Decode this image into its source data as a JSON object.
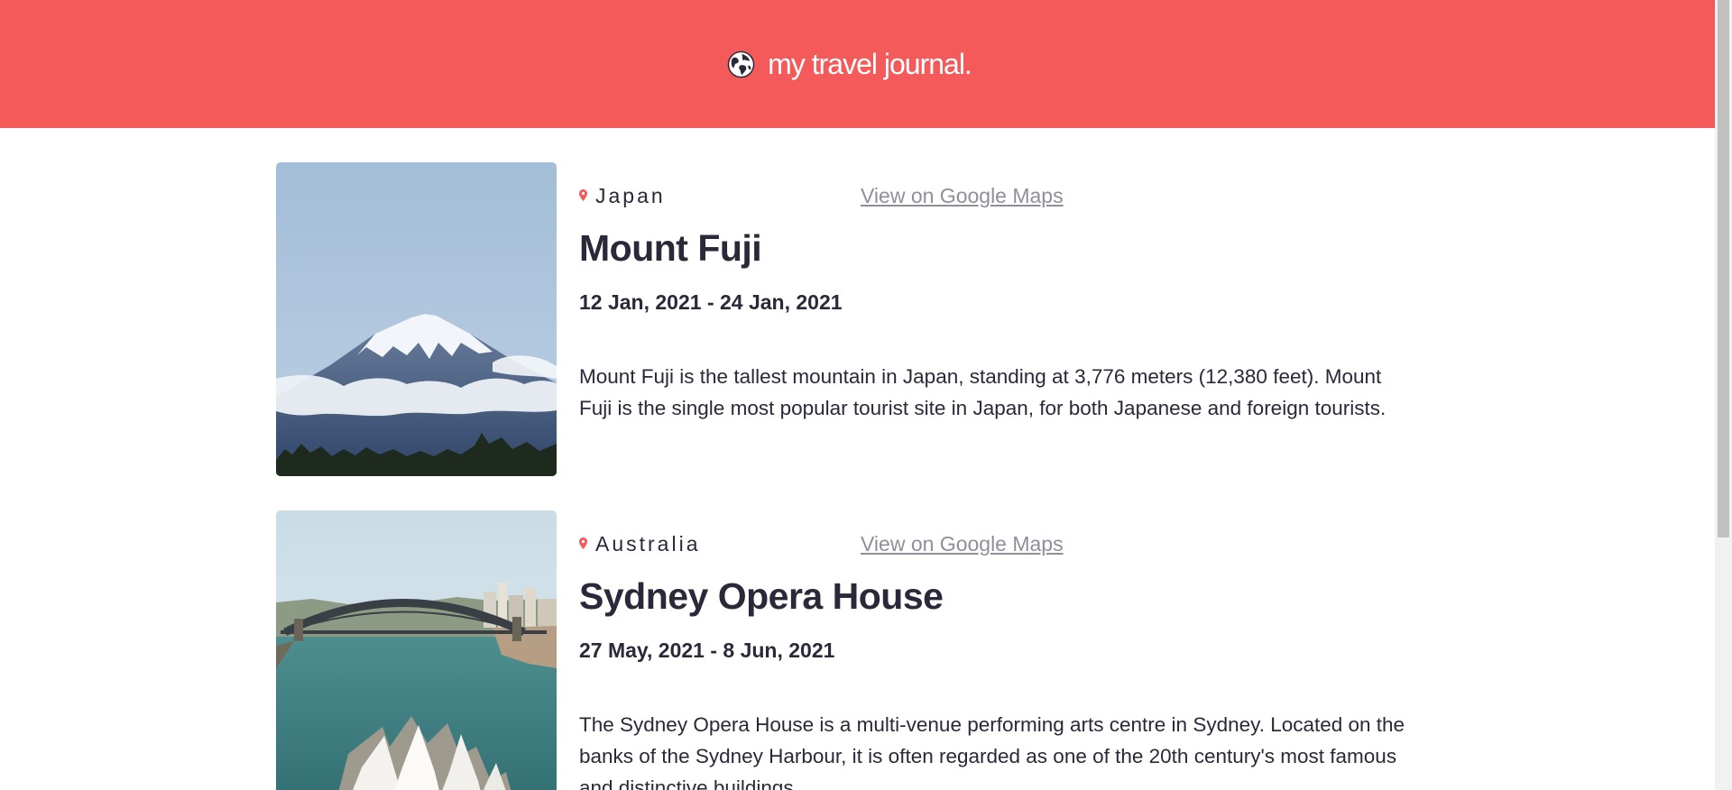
{
  "header": {
    "title": "my travel journal.",
    "icon": "globe-icon",
    "background_color": "#F55A5A"
  },
  "entries": [
    {
      "country": "Japan",
      "maps_link": "View on Google Maps",
      "title": "Mount Fuji",
      "dates": "12 Jan, 2021 - 24 Jan, 2021",
      "description": "Mount Fuji is the tallest mountain in Japan, standing at 3,776 meters (12,380 feet). Mount Fuji is the single most popular tourist site in Japan, for both Japanese and foreign tourists.",
      "image": "mount-fuji-photo"
    },
    {
      "country": "Australia",
      "maps_link": "View on Google Maps",
      "title": "Sydney Opera House",
      "dates": "27 May, 2021 - 8 Jun, 2021",
      "description": "The Sydney Opera House is a multi-venue performing arts centre in Sydney. Located on the banks of the Sydney Harbour, it is often regarded as one of the 20th century's most famous and distinctive buildings.",
      "image": "sydney-opera-house-photo"
    }
  ],
  "colors": {
    "accent": "#F55A5A",
    "text": "#2B283A",
    "link": "#918E9B"
  }
}
